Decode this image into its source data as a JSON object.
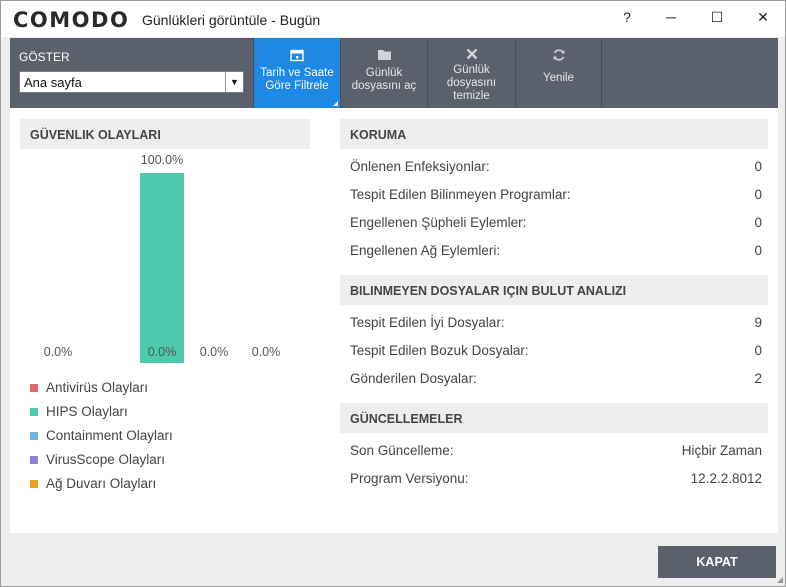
{
  "window": {
    "logo": "COMODO",
    "title": "Günlükleri görüntüle - Bugün",
    "help": "?",
    "minimize": "─",
    "maximize": "☐",
    "close": "✕"
  },
  "toolbar": {
    "show_label": "GÖSTER",
    "show_select_value": "Ana sayfa",
    "buttons": [
      {
        "label1": "Tarih ve Saate",
        "label2": "Göre Filtrele",
        "label3": "",
        "icon": "calendar-icon",
        "active": true
      },
      {
        "label1": "Günlük",
        "label2": "dosyasını aç",
        "label3": "",
        "icon": "folder-icon",
        "active": false
      },
      {
        "label1": "Günlük",
        "label2": "dosyasını",
        "label3": "temizle",
        "icon": "x-icon",
        "active": false
      },
      {
        "label1": "Yenile",
        "label2": "",
        "label3": "",
        "icon": "refresh-icon",
        "active": false
      }
    ]
  },
  "security_events": {
    "header": "GÜVENLIK OLAYLARI",
    "bars": [
      {
        "label": "0.0%",
        "value": 0.0,
        "color": "#e06666"
      },
      {
        "label": "100.0%",
        "value": 100.0,
        "color": "#4dc9ad"
      },
      {
        "label": "0.0%",
        "value": 0.0,
        "color": "#6fb7e6"
      },
      {
        "label": "0.0%",
        "value": 0.0,
        "color": "#8b7fd9"
      },
      {
        "label": "0.0%",
        "value": 0.0,
        "color": "#f0a020"
      }
    ],
    "legend": [
      {
        "label": "Antivirüs Olayları",
        "color": "#e06666"
      },
      {
        "label": "HIPS Olayları",
        "color": "#4dc9ad"
      },
      {
        "label": "Containment Olayları",
        "color": "#6fb7e6"
      },
      {
        "label": "VirusScope Olayları",
        "color": "#8b7fd9"
      },
      {
        "label": "Ağ Duvarı Olayları",
        "color": "#f0a020"
      }
    ]
  },
  "protection": {
    "header": "KORUMA",
    "rows": [
      {
        "label": "Önlenen Enfeksiyonlar:",
        "value": "0"
      },
      {
        "label": "Tespit Edilen Bilinmeyen Programlar:",
        "value": "0"
      },
      {
        "label": "Engellenen Şüpheli Eylemler:",
        "value": "0"
      },
      {
        "label": "Engellenen Ağ Eylemleri:",
        "value": "0"
      }
    ]
  },
  "cloud_analysis": {
    "header": "BILINMEYEN DOSYALAR IÇIN BULUT ANALIZI",
    "rows": [
      {
        "label": "Tespit Edilen İyi Dosyalar:",
        "value": "9"
      },
      {
        "label": "Tespit Edilen Bozuk Dosyalar:",
        "value": "0"
      },
      {
        "label": "Gönderilen Dosyalar:",
        "value": "2"
      }
    ]
  },
  "updates": {
    "header": "GÜNCELLEMELER",
    "rows": [
      {
        "label": "Son Güncelleme:",
        "value": "Hiçbir Zaman"
      },
      {
        "label": "Program Versiyonu:",
        "value": "12.2.2.8012"
      }
    ]
  },
  "footer": {
    "close_label": "KAPAT"
  }
}
